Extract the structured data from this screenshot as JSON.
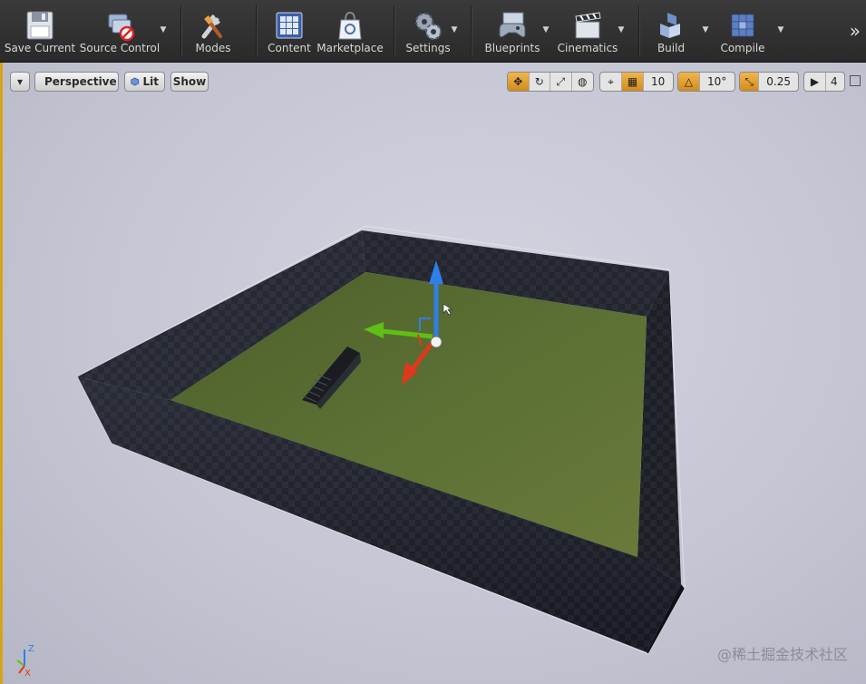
{
  "toolbar": {
    "buttons": [
      {
        "label": "Save Current",
        "icon": "floppy-disk-icon",
        "dropdown": false
      },
      {
        "label": "Source Control",
        "icon": "source-control-icon",
        "dropdown": true
      },
      {
        "label": "Modes",
        "icon": "modes-icon",
        "dropdown": false
      },
      {
        "label": "Content",
        "icon": "content-browser-icon",
        "dropdown": false
      },
      {
        "label": "Marketplace",
        "icon": "marketplace-bag-icon",
        "dropdown": false
      },
      {
        "label": "Settings",
        "icon": "settings-gears-icon",
        "dropdown": true
      },
      {
        "label": "Blueprints",
        "icon": "blueprints-gamepad-icon",
        "dropdown": true
      },
      {
        "label": "Cinematics",
        "icon": "clapperboard-icon",
        "dropdown": true
      },
      {
        "label": "Build",
        "icon": "build-cubes-icon",
        "dropdown": true
      },
      {
        "label": "Compile",
        "icon": "compile-cubes-icon",
        "dropdown": true
      }
    ],
    "more_glyph": "»"
  },
  "viewport": {
    "menu_glyph": "▾",
    "perspective_label": "Perspective",
    "lit_label": "Lit",
    "show_label": "Show",
    "grid_snap_value": "10",
    "rotation_snap_value": "10°",
    "scale_snap_value": "0.25",
    "camera_speed_value": "4",
    "accent_color": "#d8a314",
    "active_tool_color": "#e5a43a"
  },
  "axis_indicator": {
    "z": "Z",
    "x": "X"
  },
  "watermark": "@稀土掘金技术社区"
}
